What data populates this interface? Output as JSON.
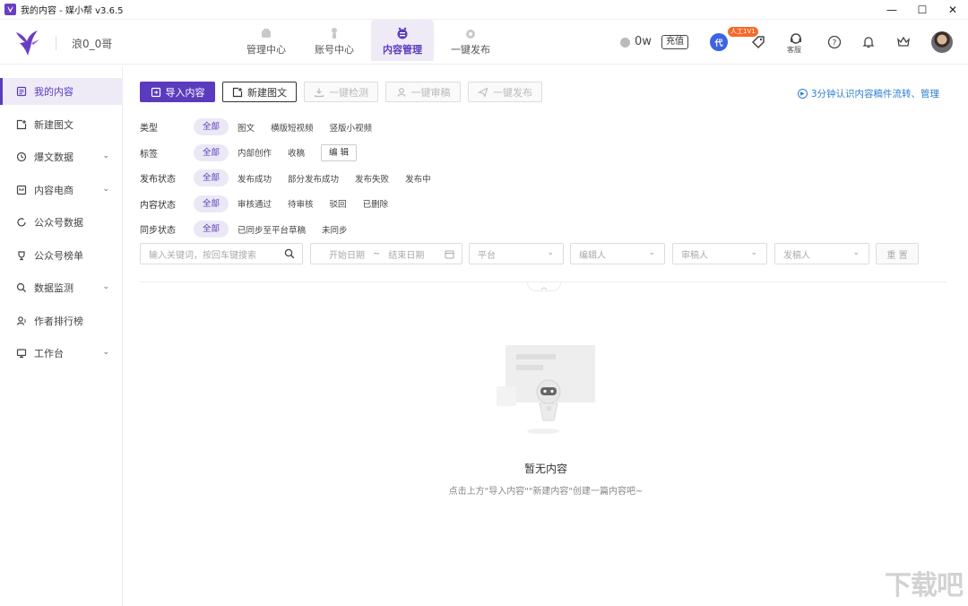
{
  "window": {
    "title": "我的内容 - 媒小帮 v3.6.5"
  },
  "header": {
    "username": "浪0_0哥",
    "nav": [
      {
        "label": "管理中心",
        "icon": "management-icon"
      },
      {
        "label": "账号中心",
        "icon": "account-icon"
      },
      {
        "label": "内容管理",
        "icon": "content-icon",
        "active": true
      },
      {
        "label": "一键发布",
        "icon": "publish-icon"
      }
    ],
    "balance": "0w",
    "recharge_label": "充值",
    "manual_badge": "人工1V1",
    "dai_label": "代",
    "kefu_label": "客服"
  },
  "sidebar": {
    "items": [
      {
        "label": "我的内容",
        "active": true
      },
      {
        "label": "新建图文"
      },
      {
        "label": "爆文数据",
        "expandable": true
      },
      {
        "label": "内容电商",
        "expandable": true
      },
      {
        "label": "公众号数据"
      },
      {
        "label": "公众号榜单"
      },
      {
        "label": "数据监测",
        "expandable": true
      },
      {
        "label": "作者排行榜"
      },
      {
        "label": "工作台",
        "expandable": true
      }
    ]
  },
  "toolbar": {
    "import": "导入内容",
    "new_article": "新建图文",
    "check": "一键检测",
    "review": "一键审稿",
    "publish": "一键发布",
    "help_link": "3分钟认识内容稿件流转、管理"
  },
  "filters": {
    "type": {
      "label": "类型",
      "options": [
        "全部",
        "图文",
        "横版短视频",
        "竖版小视频"
      ]
    },
    "tag": {
      "label": "标签",
      "options": [
        "全部",
        "内部创作",
        "收稿"
      ],
      "edit": "编 辑"
    },
    "publish_status": {
      "label": "发布状态",
      "options": [
        "全部",
        "发布成功",
        "部分发布成功",
        "发布失败",
        "发布中"
      ]
    },
    "content_status": {
      "label": "内容状态",
      "options": [
        "全部",
        "审核通过",
        "待审核",
        "驳回",
        "已删除"
      ]
    },
    "sync_status": {
      "label": "同步状态",
      "options": [
        "全部",
        "已同步至平台草稿",
        "未同步"
      ]
    }
  },
  "search": {
    "keyword_placeholder": "输入关键词，按回车键搜索",
    "start_date": "开始日期",
    "date_sep": "~",
    "end_date": "结束日期",
    "platform": "平台",
    "editor": "编辑人",
    "reviewer": "审稿人",
    "publisher": "发稿人",
    "reset": "重 置"
  },
  "empty": {
    "title": "暂无内容",
    "subtitle": "点击上方\"导入内容\"\"新建内容\"创建一篇内容吧~"
  },
  "watermark": "下载吧"
}
